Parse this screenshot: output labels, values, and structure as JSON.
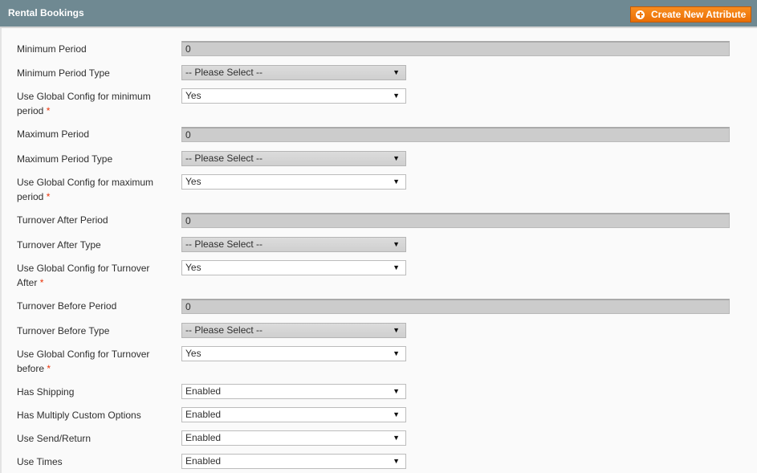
{
  "header": {
    "title": "Rental Bookings",
    "create_button_label": "Create New Attribute"
  },
  "fields": [
    {
      "label": "Minimum Period",
      "type": "text",
      "value": "0",
      "required": false
    },
    {
      "label": "Minimum Period Type",
      "type": "select",
      "value": "-- Please Select --",
      "required": false
    },
    {
      "label_line1": "Use Global Config for minimum",
      "label_line2": "period",
      "type": "select",
      "value": "Yes",
      "required": true
    },
    {
      "label": "Maximum Period",
      "type": "text",
      "value": "0",
      "required": false
    },
    {
      "label": "Maximum Period Type",
      "type": "select",
      "value": "-- Please Select --",
      "required": false
    },
    {
      "label_line1": "Use Global Config for maximum",
      "label_line2": "period",
      "type": "select",
      "value": "Yes",
      "required": true
    },
    {
      "label": "Turnover After Period",
      "type": "text",
      "value": "0",
      "required": false
    },
    {
      "label": "Turnover After Type",
      "type": "select",
      "value": "-- Please Select --",
      "required": false
    },
    {
      "label_line1": "Use Global Config for Turnover",
      "label_line2": "After",
      "type": "select",
      "value": "Yes",
      "required": true
    },
    {
      "label": "Turnover Before Period",
      "type": "text",
      "value": "0",
      "required": false
    },
    {
      "label": "Turnover Before Type",
      "type": "select",
      "value": "-- Please Select --",
      "required": false
    },
    {
      "label_line1": "Use Global Config for Turnover",
      "label_line2": "before",
      "type": "select",
      "value": "Yes",
      "required": true
    },
    {
      "label": "Has Shipping",
      "type": "select",
      "value": "Enabled",
      "required": false
    },
    {
      "label": "Has Multiply Custom Options",
      "type": "select",
      "value": "Enabled",
      "required": false
    },
    {
      "label": "Use Send/Return",
      "type": "select",
      "value": "Enabled",
      "required": false
    },
    {
      "label": "Use Times",
      "type": "select",
      "value": "Enabled",
      "required": false
    }
  ],
  "required_marker": "*",
  "caret_glyph": "▼"
}
